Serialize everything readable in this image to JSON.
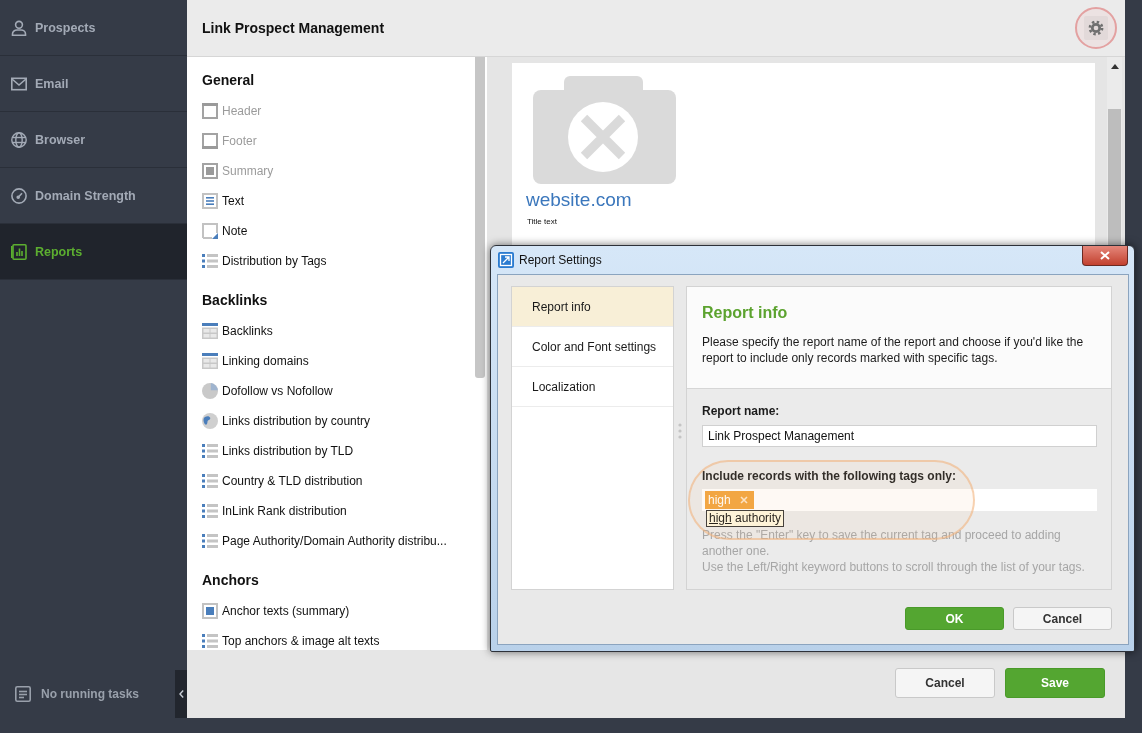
{
  "sidebar": {
    "items": [
      {
        "label": "Prospects",
        "kind": "person",
        "selected": false
      },
      {
        "label": "Email",
        "kind": "envelope",
        "selected": false
      },
      {
        "label": "Browser",
        "kind": "globe",
        "selected": false
      },
      {
        "label": "Domain Strength",
        "kind": "gauge",
        "selected": false
      },
      {
        "label": "Reports",
        "kind": "report",
        "selected": true
      }
    ],
    "tasks": "No running tasks"
  },
  "header": {
    "title": "Link Prospect Management",
    "settings": {
      "highlighted": true
    }
  },
  "elements": {
    "sections": [
      {
        "title": "General",
        "items": [
          {
            "label": "Header",
            "kind": "header",
            "disabled": true
          },
          {
            "label": "Footer",
            "kind": "footer",
            "disabled": true
          },
          {
            "label": "Summary",
            "kind": "summary",
            "disabled": true
          },
          {
            "label": "Text",
            "kind": "text",
            "disabled": false
          },
          {
            "label": "Note",
            "kind": "note",
            "disabled": false
          },
          {
            "label": "Distribution by Tags",
            "kind": "list",
            "disabled": false
          }
        ]
      },
      {
        "title": "Backlinks",
        "items": [
          {
            "label": "Backlinks",
            "kind": "table",
            "disabled": false
          },
          {
            "label": "Linking domains",
            "kind": "table",
            "disabled": false
          },
          {
            "label": "Dofollow vs Nofollow",
            "kind": "pie",
            "disabled": false
          },
          {
            "label": "Links distribution by country",
            "kind": "globe",
            "disabled": false
          },
          {
            "label": "Links distribution by TLD",
            "kind": "list",
            "disabled": false
          },
          {
            "label": "Country & TLD distribution",
            "kind": "list",
            "disabled": false
          },
          {
            "label": "InLink Rank distribution",
            "kind": "list",
            "disabled": false
          },
          {
            "label": "Page Authority/Domain Authority distribu...",
            "kind": "list",
            "disabled": false
          }
        ]
      },
      {
        "title": "Anchors",
        "items": [
          {
            "label": "Anchor texts (summary)",
            "kind": "summary",
            "disabled": false
          },
          {
            "label": "Top anchors & image alt texts",
            "kind": "list",
            "disabled": false
          }
        ]
      }
    ]
  },
  "preview": {
    "site": "website.com",
    "title_text": "Title text"
  },
  "footer": {
    "buttons": [
      {
        "label": "Cancel",
        "kind": "secondary"
      },
      {
        "label": "Save",
        "kind": "primary"
      }
    ]
  },
  "dialog": {
    "title": "Report Settings",
    "nav": [
      {
        "label": "Report info",
        "selected": true
      },
      {
        "label": "Color and Font settings",
        "selected": false
      },
      {
        "label": "Localization",
        "selected": false
      }
    ],
    "heading": "Report info",
    "description": "Please specify the report name of the report and choose if you'd like the report to include only records marked with specific tags.",
    "name_field": {
      "label": "Report name:",
      "value": "Link Prospect Management"
    },
    "tags_field": {
      "label": "Include records with the following tags only:",
      "highlighted": true,
      "tags": [
        "high"
      ],
      "suggestion": {
        "matched": "high",
        "rest": "authority"
      }
    },
    "hints": [
      "Press the \"Enter\" key to save the current tag and proceed to adding another one.",
      "Use the Left/Right keyword buttons to scroll through the list of your tags."
    ],
    "buttons": [
      {
        "label": "OK",
        "kind": "primary"
      },
      {
        "label": "Cancel",
        "kind": "secondary"
      }
    ]
  }
}
